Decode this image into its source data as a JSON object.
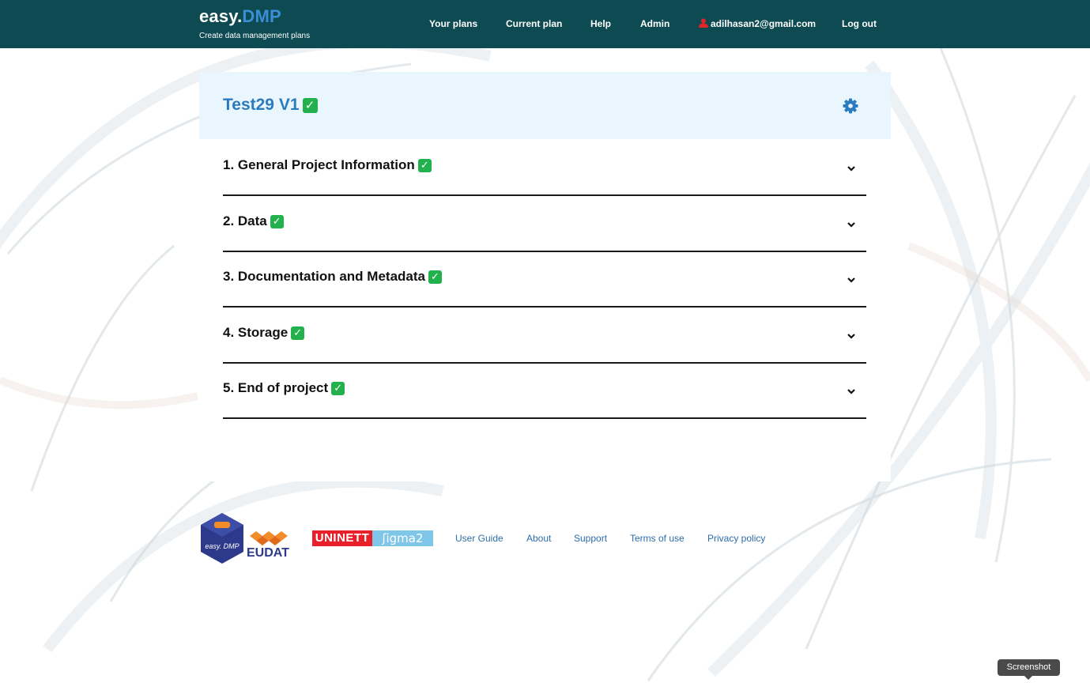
{
  "header": {
    "brand_main": "easy.",
    "brand_accent": "DMP",
    "tagline": "Create data management plans",
    "nav": {
      "your_plans": "Your plans",
      "current_plan": "Current plan",
      "help": "Help",
      "admin": "Admin",
      "user_email": "adilhasan2@gmail.com",
      "logout": "Log out"
    }
  },
  "plan": {
    "title": "Test29 V1",
    "status_icon": "check-mark-button-icon",
    "sections": [
      {
        "label": "1. General Project Information"
      },
      {
        "label": "2. Data"
      },
      {
        "label": "3. Documentation and Metadata"
      },
      {
        "label": "4. Storage"
      },
      {
        "label": "5. End of project"
      }
    ]
  },
  "footer": {
    "logos": {
      "easydmp": "easy. DMP",
      "eudat": "EUDAT",
      "uninett": "UNINETT",
      "sigma2": "ʃigma2"
    },
    "links": {
      "user_guide": "User Guide",
      "about": "About",
      "support": "Support",
      "terms": "Terms of use",
      "privacy": "Privacy policy"
    }
  },
  "tooltip": "Screenshot",
  "colors": {
    "topbar": "#0d4a52",
    "accent": "#2b7bbf",
    "check": "#22b14c",
    "header_panel": "#eaf6fd"
  }
}
